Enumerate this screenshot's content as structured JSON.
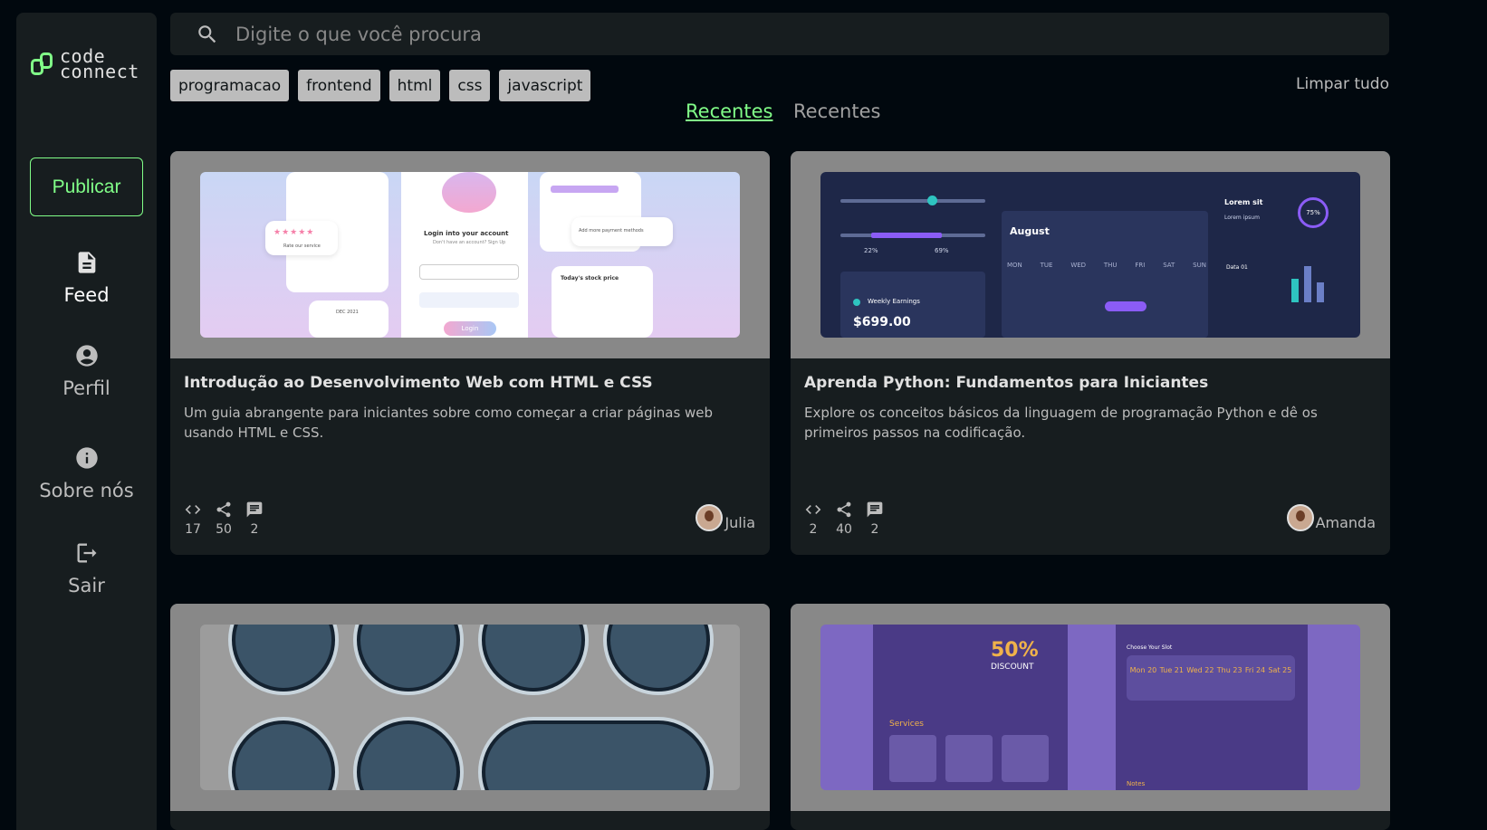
{
  "app": {
    "logo_line1": "code",
    "logo_line2": "connect"
  },
  "sidebar": {
    "publish_label": "Publicar",
    "items": [
      {
        "label": "Feed",
        "icon": "document-icon"
      },
      {
        "label": "Perfil",
        "icon": "account-circle-icon"
      },
      {
        "label": "Sobre nós",
        "icon": "info-icon"
      },
      {
        "label": "Sair",
        "icon": "logout-icon"
      }
    ]
  },
  "search": {
    "placeholder": "Digite o que você procura",
    "value": ""
  },
  "tags": [
    "programacao",
    "frontend",
    "html",
    "css",
    "javascript"
  ],
  "clear_all_label": "Limpar tudo",
  "tabs": [
    {
      "label": "Recentes",
      "active": true
    },
    {
      "label": "Recentes",
      "active": false
    }
  ],
  "cards": [
    {
      "title": "Introdução ao Desenvolvimento Web com HTML e CSS",
      "description": "Um guia abrangente para iniciantes sobre como começar a criar páginas web usando HTML e CSS.",
      "code_count": "17",
      "share_count": "50",
      "comment_count": "2",
      "author": "Julia",
      "preview": {
        "login_title": "Login into your account",
        "login_sub": "Don't have an account? Sign Up",
        "login_btn": "Login",
        "rate_label": "Rate our service",
        "stock_label": "Today's stock price",
        "payment_label": "Add more payment methods",
        "calendar_label": "DEC 2021"
      }
    },
    {
      "title": "Aprenda Python: Fundamentos para Iniciantes",
      "description": "Explore os conceitos básicos da linguagem de programação Python e dê os primeiros passos na codificação.",
      "code_count": "2",
      "share_count": "40",
      "comment_count": "2",
      "author": "Amanda",
      "preview": {
        "month": "August",
        "weekdays": [
          "MON",
          "TUE",
          "WED",
          "THU",
          "FRI",
          "SAT",
          "SUN"
        ],
        "earnings_label": "Weekly Earnings",
        "earnings_value": "$699.00",
        "pct_low": "22%",
        "pct_high": "69%",
        "lorem1": "Lorem ipsum",
        "lorem_sit": "Lorem sit",
        "ring_value": "75%",
        "data_label": "Data 01"
      }
    },
    {
      "title": "",
      "description": "",
      "author": ""
    },
    {
      "title": "",
      "description": "",
      "author": "",
      "preview": {
        "discount": "50%",
        "discount_label": "DISCOUNT",
        "services_label": "Services",
        "slot_label": "Choose Your Slot",
        "days": [
          "Mon",
          "Tue",
          "Wed",
          "Thu",
          "Fri",
          "Sat"
        ],
        "dates": [
          "20",
          "21",
          "22",
          "23",
          "24",
          "25"
        ],
        "notes_label": "Notes"
      }
    }
  ],
  "colors": {
    "accent": "#81fe88",
    "background": "#01080e",
    "surface": "#171d1f",
    "tag_bg": "#bcbcbc"
  }
}
